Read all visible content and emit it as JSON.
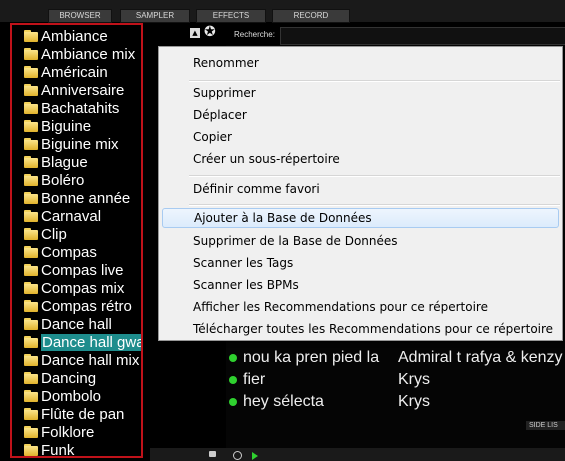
{
  "tabs": [
    "BROWSER",
    "SAMPLER",
    "EFFECTS",
    "RECORD"
  ],
  "search": {
    "label": "Recherche:",
    "value": ""
  },
  "folders": [
    "Ambiance",
    "Ambiance mix",
    "Américain",
    "Anniversaire",
    "Bachatahits",
    "Biguine",
    "Biguine mix",
    "Blague",
    "Boléro",
    "Bonne année",
    "Carnaval",
    "Clip",
    "Compas",
    "Compas live",
    "Compas mix",
    "Compas rétro",
    "Dance hall",
    "Dance hall gwada",
    "Dance hall mix",
    "Dancing",
    "Dombolo",
    "Flûte de pan",
    "Folklore",
    "Funk"
  ],
  "selected_folder": "Dance hall gwada",
  "tracks": [
    {
      "title": "nou ka pren pied la",
      "artist": "Admiral t rafya & kenzy"
    },
    {
      "title": "fier",
      "artist": "Krys"
    },
    {
      "title": "hey sélecta",
      "artist": "Krys"
    }
  ],
  "side_list_label": "SIDE LIS",
  "context_menu": {
    "items": [
      "Renommer",
      "Supprimer",
      "Déplacer",
      "Copier",
      "Créer un sous-répertoire",
      "Définir comme favori",
      "Ajouter à la Base de Données",
      "Supprimer de la Base de Données",
      "Scanner les Tags",
      "Scanner les BPMs",
      "Afficher les Recommendations pour ce répertoire",
      "Télécharger toutes les Recommendations pour ce répertoire"
    ],
    "highlighted": "Ajouter à la Base de Données"
  },
  "colors": {
    "accent_selection": "#1e8d8d",
    "panel_border": "#c0121a",
    "play_dot": "#2fd12f"
  }
}
